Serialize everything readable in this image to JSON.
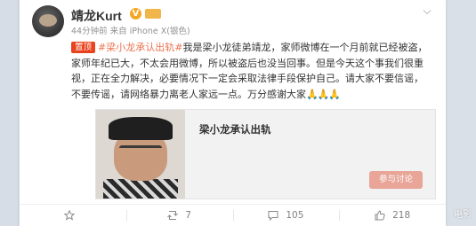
{
  "post": {
    "username": "靖龙Kurt",
    "verified_mark": "V",
    "level_badge": "",
    "meta": "44分钟前 来自 iPhone X(银色)",
    "pin_label": "置顶",
    "topic": "#梁小龙承认出轨#",
    "body": "我是梁小龙徒弟靖龙，家师微博在一个月前就已经被盗，家师年纪已大，不太会用微博，所以被盗后也没当回事。但是今天这个事我们很重视，正在全力解决，必要情况下一定会采取法律手段保护自己。请大家不要信谣，不要传谣，请网络暴力离老人家远一点。万分感谢大家",
    "emoji": "🙏🙏🙏"
  },
  "share_card": {
    "title": "梁小龙承认出轨",
    "button_label": "参与讨论"
  },
  "actions": {
    "star": "",
    "repost": "7",
    "comment": "105",
    "like": "218"
  },
  "watermark": "电影"
}
